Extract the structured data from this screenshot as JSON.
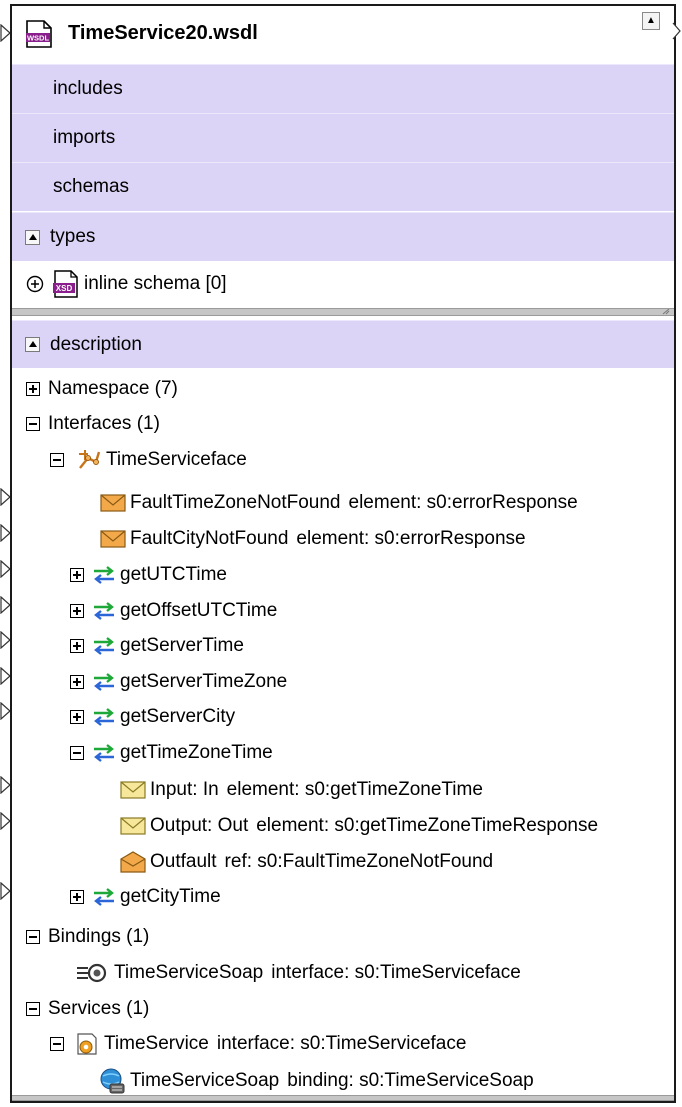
{
  "title": "TimeService20.wsdl",
  "icons": {
    "file": "wsdl-file-icon",
    "schema": "xsd-schema-icon",
    "interface": "interface-icon",
    "message": "envelope-icon",
    "operation": "swap-arrows-icon",
    "binding": "binding-icon",
    "service": "service-icon",
    "port": "globe-port-icon"
  },
  "colors": {
    "section_bg": "#dcd4f6",
    "operation_arrow": "#1fa83a",
    "operation_arrow_back": "#2a66d8",
    "envelope_orange": "#f3a94a",
    "envelope_yellow": "#f6e79a"
  },
  "sections": [
    {
      "label": "includes"
    },
    {
      "label": "imports"
    },
    {
      "label": "schemas"
    },
    {
      "label": "types"
    }
  ],
  "types_item": {
    "label": "inline schema [0]"
  },
  "description": {
    "label": "description",
    "namespace": "Namespace (7)",
    "interfaces": "Interfaces (1)",
    "interface_name": "TimeServiceface",
    "faults": [
      {
        "name": "FaultTimeZoneNotFound",
        "detail": "element: s0:errorResponse"
      },
      {
        "name": "FaultCityNotFound",
        "detail": "element: s0:errorResponse"
      }
    ],
    "operations": [
      {
        "name": "getUTCTime"
      },
      {
        "name": "getOffsetUTCTime"
      },
      {
        "name": "getServerTime"
      },
      {
        "name": "getServerTimeZone"
      },
      {
        "name": "getServerCity"
      },
      {
        "name": "getTimeZoneTime"
      }
    ],
    "messages": [
      {
        "name": "Input: In",
        "detail": "element: s0:getTimeZoneTime"
      },
      {
        "name": "Output: Out",
        "detail": "element: s0:getTimeZoneTimeResponse"
      },
      {
        "name": "Outfault",
        "detail": "ref: s0:FaultTimeZoneNotFound"
      }
    ],
    "last_operation": "getCityTime",
    "bindings": "Bindings (1)",
    "binding_item": {
      "name": "TimeServiceSoap",
      "detail": "interface: s0:TimeServiceface"
    },
    "services": "Services (1)",
    "service_item": {
      "name": "TimeService",
      "detail": "interface: s0:TimeServiceface"
    },
    "endpoint_item": {
      "name": "TimeServiceSoap",
      "detail": "binding: s0:TimeServiceSoap"
    }
  }
}
